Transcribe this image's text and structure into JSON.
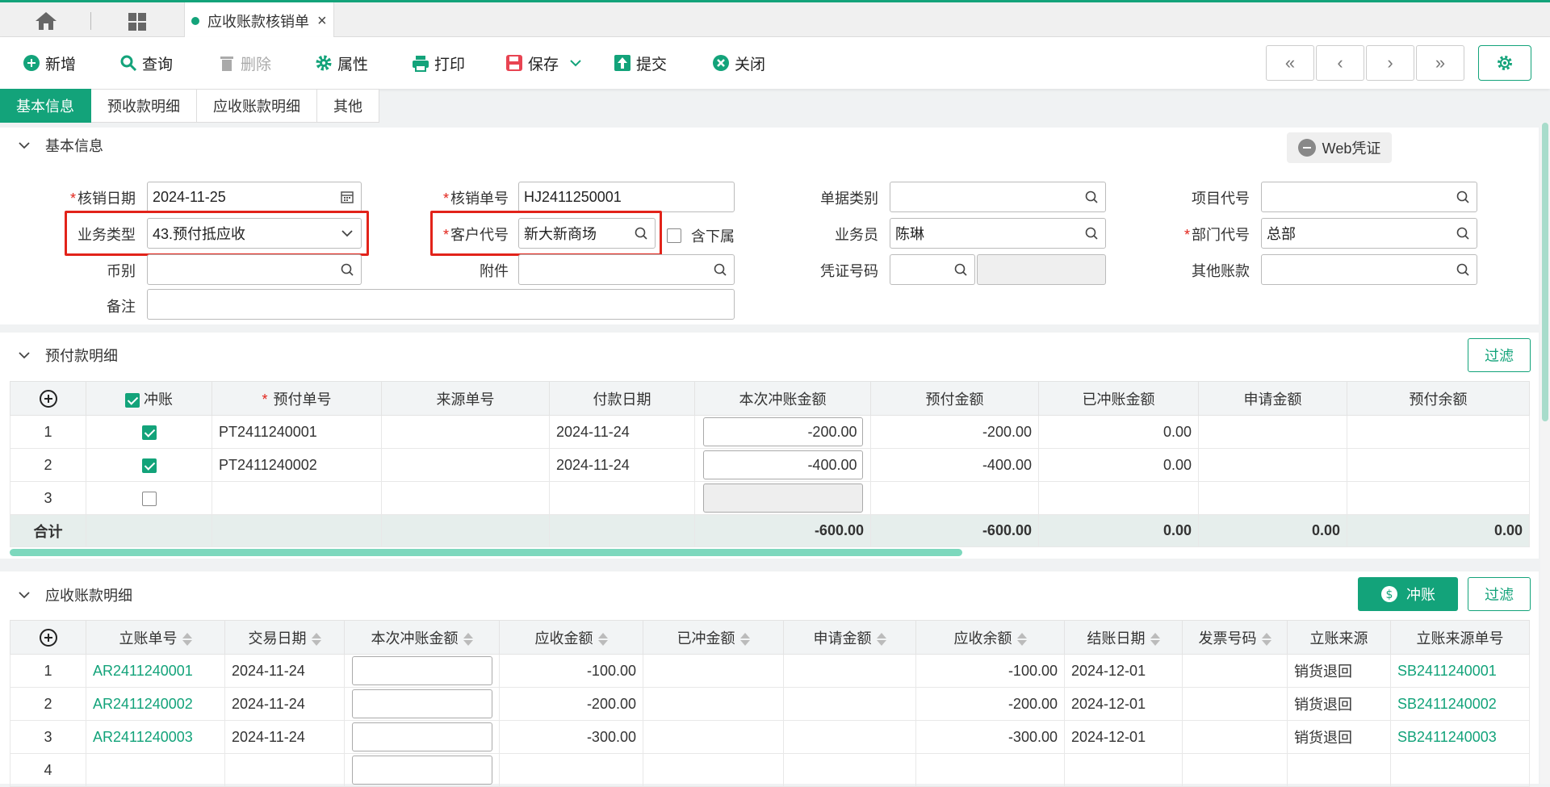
{
  "tab": {
    "title": "应收账款核销单",
    "close": "×"
  },
  "toolbar": {
    "add": "新增",
    "query": "查询",
    "delete": "删除",
    "props": "属性",
    "print": "打印",
    "save": "保存",
    "submit": "提交",
    "close": "关闭",
    "nav": [
      "«",
      "‹",
      "›",
      "»"
    ]
  },
  "tabs": [
    "基本信息",
    "预收款明细",
    "应收账款明细",
    "其他"
  ],
  "basic": {
    "section_title": "基本信息",
    "web_voucher": "Web凭证",
    "labels": {
      "date": "核销日期",
      "number": "核销单号",
      "doc_type": "单据类别",
      "project": "项目代号",
      "biz_type": "业务类型",
      "customer": "客户代号",
      "include_sub": "含下属",
      "salesman": "业务员",
      "dept": "部门代号",
      "currency": "币别",
      "attachment": "附件",
      "voucher": "凭证号码",
      "other_account": "其他账款",
      "remark": "备注"
    },
    "values": {
      "date": "2024-11-25",
      "number": "HJ2411250001",
      "biz_type": "43.预付抵应收",
      "customer": "新大新商场",
      "salesman": "陈琳",
      "dept": "总部"
    },
    "required": "*"
  },
  "prepay": {
    "section_title": "预付款明细",
    "filter": "过滤",
    "headers": [
      "冲账",
      "预付单号",
      "来源单号",
      "付款日期",
      "本次冲账金额",
      "预付金额",
      "已冲账金额",
      "申请金额",
      "预付余额"
    ],
    "rows": [
      {
        "no": "1",
        "checked": true,
        "id": "PT2411240001",
        "src": "",
        "date": "2024-11-24",
        "amount": "-200.00",
        "prepaid": "-200.00",
        "offset": "0.00",
        "apply": "",
        "balance": ""
      },
      {
        "no": "2",
        "checked": true,
        "id": "PT2411240002",
        "src": "",
        "date": "2024-11-24",
        "amount": "-400.00",
        "prepaid": "-400.00",
        "offset": "0.00",
        "apply": "",
        "balance": ""
      },
      {
        "no": "3",
        "checked": false,
        "id": "",
        "src": "",
        "date": "",
        "amount": "",
        "prepaid": "",
        "offset": "",
        "apply": "",
        "balance": ""
      }
    ],
    "total": {
      "label": "合计",
      "amount": "-600.00",
      "prepaid": "-600.00",
      "offset": "0.00",
      "apply": "0.00",
      "balance": "0.00"
    }
  },
  "ar": {
    "section_title": "应收账款明细",
    "offset_btn": "冲账",
    "filter": "过滤",
    "headers": [
      "立账单号",
      "交易日期",
      "本次冲账金额",
      "应收金额",
      "已冲金额",
      "申请金额",
      "应收余额",
      "结账日期",
      "发票号码",
      "立账来源",
      "立账来源单号"
    ],
    "rows": [
      {
        "no": "1",
        "id": "AR2411240001",
        "date": "2024-11-24",
        "amount": "",
        "receivable": "-100.00",
        "offset": "",
        "apply": "",
        "balance": "-100.00",
        "close_date": "2024-12-01",
        "invoice": "",
        "source": "销货退回",
        "source_no": "SB2411240001"
      },
      {
        "no": "2",
        "id": "AR2411240002",
        "date": "2024-11-24",
        "amount": "",
        "receivable": "-200.00",
        "offset": "",
        "apply": "",
        "balance": "-200.00",
        "close_date": "2024-12-01",
        "invoice": "",
        "source": "销货退回",
        "source_no": "SB2411240002"
      },
      {
        "no": "3",
        "id": "AR2411240003",
        "date": "2024-11-24",
        "amount": "",
        "receivable": "-300.00",
        "offset": "",
        "apply": "",
        "balance": "-300.00",
        "close_date": "2024-12-01",
        "invoice": "",
        "source": "销货退回",
        "source_no": "SB2411240003"
      },
      {
        "no": "4",
        "id": "",
        "date": "",
        "amount": "",
        "receivable": "",
        "offset": "",
        "apply": "",
        "balance": "",
        "close_date": "",
        "invoice": "",
        "source": "",
        "source_no": ""
      }
    ]
  },
  "colors": {
    "accent": "#13a37a",
    "highlight": "#e2231a"
  }
}
